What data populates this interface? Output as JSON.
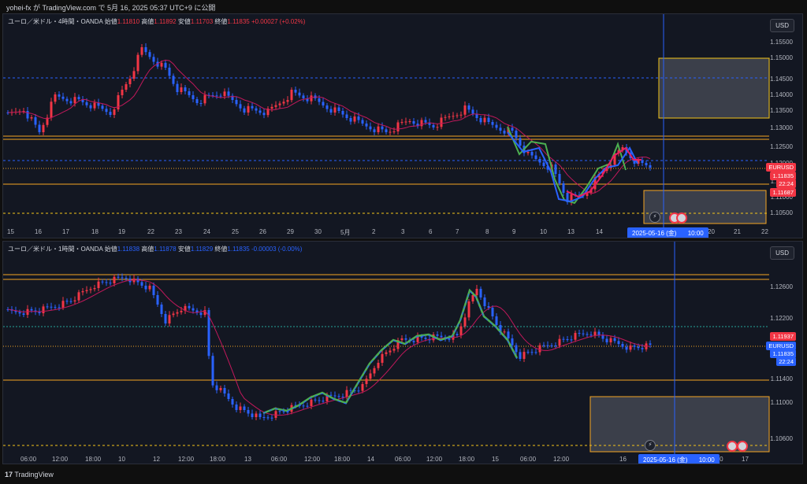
{
  "header": {
    "text": "yohei-fx が TradingView.com で 5月 16, 2025 05:37 UTC+9 に公開"
  },
  "footer": {
    "logo_text": "TradingView"
  },
  "colors": {
    "bg": "#131722",
    "up": "#f23645",
    "down": "#2962ff",
    "ma": "#c2185b",
    "hline_orange": "#f5a623",
    "hline_blue": "#2962ff",
    "zone_border": "#f5c518"
  },
  "pane1": {
    "legend": {
      "symbol": "ユーロ／米ドル・4時間・OANDA",
      "open_label": "始値",
      "open": "1.11810",
      "high_label": "高値",
      "high": "1.11892",
      "low_label": "安値",
      "low": "1.11703",
      "close_label": "終値",
      "close": "1.11835",
      "change": "+0.00027 (+0.02%)"
    },
    "currency": "USD",
    "y_labels": [
      "1.15500",
      "1.15000",
      "1.14500",
      "1.14000",
      "1.13500",
      "1.13000",
      "1.12500",
      "1.12000",
      "1.11500",
      "1.11000",
      "1.10500"
    ],
    "x_labels": [
      "15",
      "16",
      "17",
      "18",
      "19",
      "22",
      "23",
      "24",
      "25",
      "26",
      "29",
      "30",
      "5月",
      "2",
      "3",
      "6",
      "7",
      "8",
      "9",
      "10",
      "13",
      "14",
      "20",
      "21",
      "22"
    ],
    "price_tag": {
      "symbol": "EURUSD",
      "price": "1.11835",
      "countdown": "22:24"
    },
    "level_tag": "1.11687",
    "date_tag": {
      "date": "2025-05-16 (金)",
      "time": "10:00"
    }
  },
  "pane2": {
    "legend": {
      "symbol": "ユーロ／米ドル・1時間・OANDA",
      "open_label": "始値",
      "open": "1.11838",
      "high_label": "高値",
      "high": "1.11878",
      "low_label": "安値",
      "low": "1.11829",
      "close_label": "終値",
      "close": "1.11835",
      "change": "-0.00003 (-0.00%)"
    },
    "currency": "USD",
    "y_labels": [
      "1.12600",
      "1.12200",
      "1.11800",
      "1.11400",
      "1.11000",
      "1.10600"
    ],
    "x_labels": [
      "06:00",
      "12:00",
      "18:00",
      "10",
      "12",
      "12:00",
      "18:00",
      "13",
      "06:00",
      "12:00",
      "18:00",
      "14",
      "06:00",
      "12:00",
      "18:00",
      "15",
      "06:00",
      "12:00",
      "16",
      "8:00",
      "17"
    ],
    "price_tag": {
      "symbol": "EURUSD",
      "price": "1.11835",
      "countdown": "22:24"
    },
    "level_tag": "1.11937",
    "date_tag": {
      "date": "2025-05-16 (金)",
      "time": "10:00"
    }
  }
}
